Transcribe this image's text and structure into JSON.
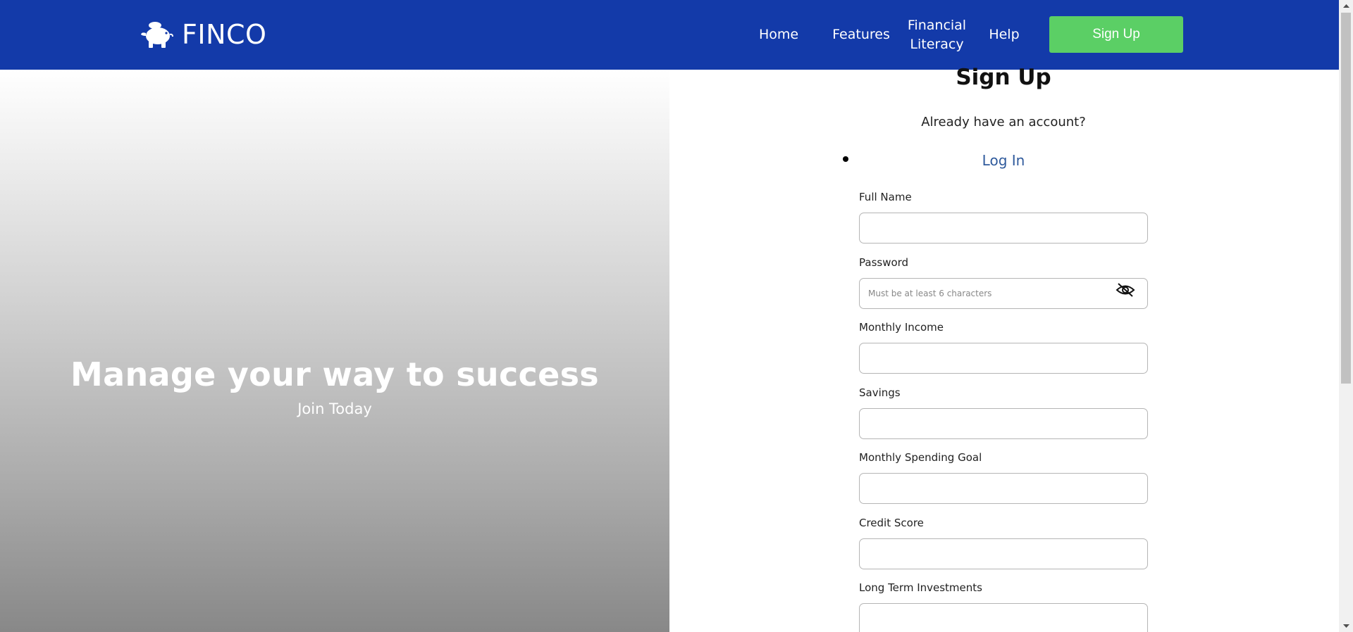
{
  "header": {
    "brand": "FINCO",
    "nav": [
      {
        "label": "Home"
      },
      {
        "label": "Features"
      },
      {
        "label": "Financial Literacy"
      },
      {
        "label": "Help"
      }
    ],
    "signup_label": "Sign Up"
  },
  "hero": {
    "title": "Manage your way to success",
    "subtitle": "Join Today"
  },
  "form": {
    "title": "Sign Up",
    "account_question": "Already have an account?",
    "login_label": "Log In",
    "fields": [
      {
        "label": "Full Name",
        "value": "",
        "placeholder": ""
      },
      {
        "label": "Password",
        "value": "",
        "placeholder": "Must be at least 6 characters"
      },
      {
        "label": "Monthly Income",
        "value": "",
        "placeholder": ""
      },
      {
        "label": "Savings",
        "value": "",
        "placeholder": ""
      },
      {
        "label": "Monthly Spending Goal",
        "value": "",
        "placeholder": ""
      },
      {
        "label": "Credit Score",
        "value": "",
        "placeholder": ""
      },
      {
        "label": "Long Term Investments",
        "value": "",
        "placeholder": ""
      }
    ]
  },
  "colors": {
    "header_bg": "#133aa9",
    "signup_button": "#5bcf65",
    "link": "#2f5a9c"
  },
  "icons": {
    "brand": "piggy-bank-icon",
    "password_toggle": "eye-slash-icon"
  }
}
